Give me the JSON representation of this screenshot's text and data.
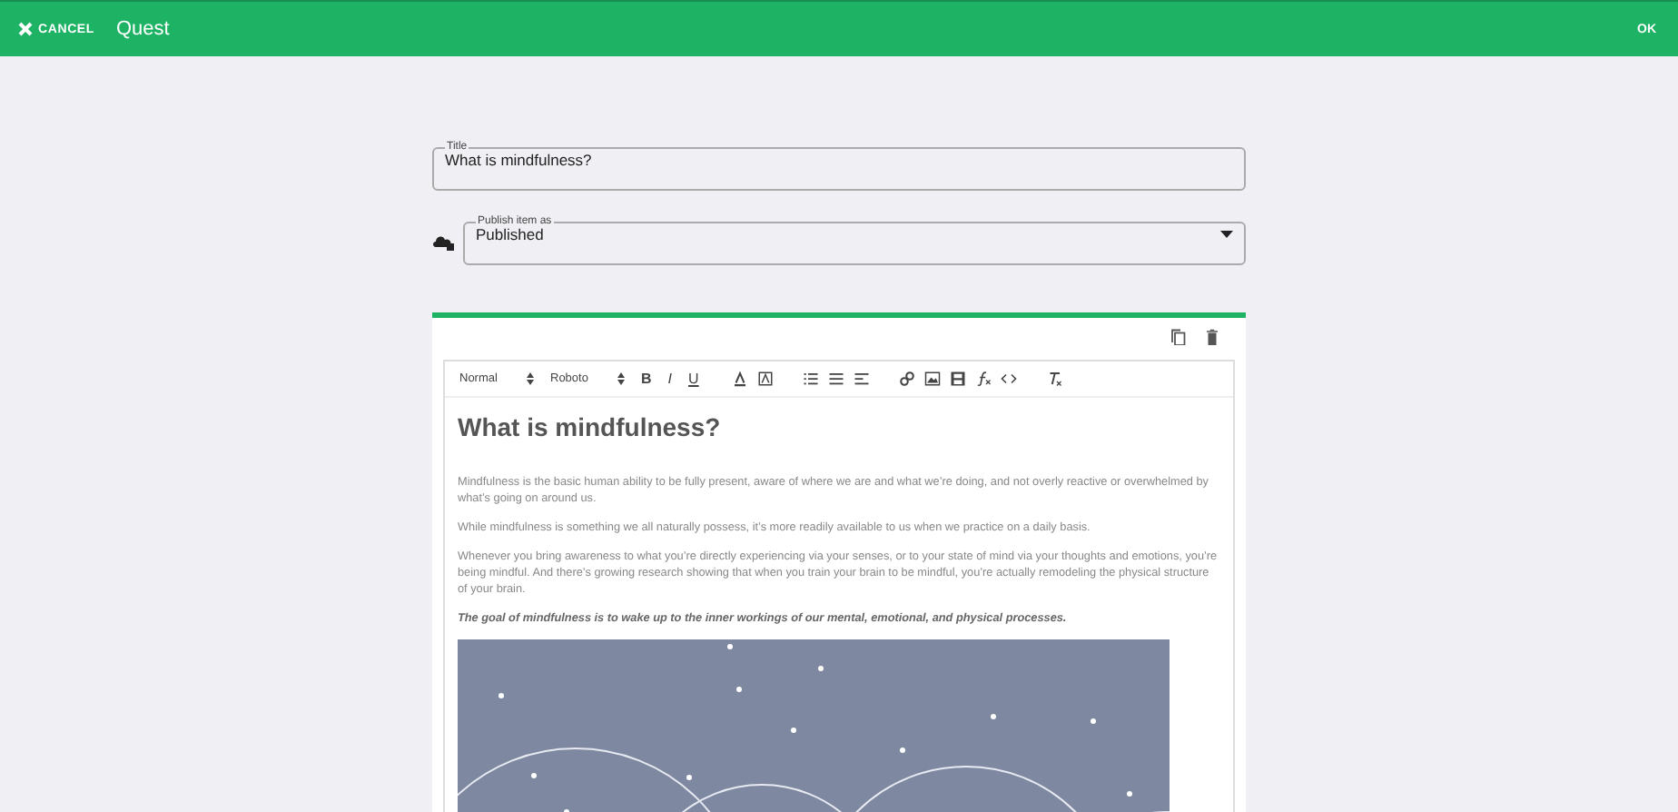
{
  "app_bar": {
    "cancel": "CANCEL",
    "title": "Quest",
    "ok": "OK"
  },
  "title_field": {
    "label": "Title",
    "value": "What is mindfulness?"
  },
  "publish_field": {
    "label": "Publish item as",
    "value": "Published"
  },
  "toolbar": {
    "header_select": "Normal",
    "font_select": "Roboto",
    "format_buttons": [
      "B",
      "I",
      "U"
    ]
  },
  "content": {
    "heading": "What is mindfulness?",
    "paragraphs": [
      {
        "kind": "plain",
        "text": "Mindfulness is the basic human ability to be fully present, aware of where we are and what we’re doing, and not overly reactive or overwhelmed by what’s going on around us."
      },
      {
        "kind": "plain",
        "text": "While mindfulness is something we all naturally possess, it’s more readily available to us when we practice on a daily basis."
      },
      {
        "kind": "plain",
        "text": "Whenever you bring awareness to what you’re directly experiencing via your senses, or to your state of mind via your thoughts and emotions, you’re being mindful. And there’s growing research showing that when you train your brain to be mindful, you’re actually remodeling the physical structure of your brain."
      },
      {
        "kind": "emphasis",
        "text": "The goal of mindfulness is to wake up to the inner workings of our mental, emotional, and physical processes."
      }
    ]
  }
}
